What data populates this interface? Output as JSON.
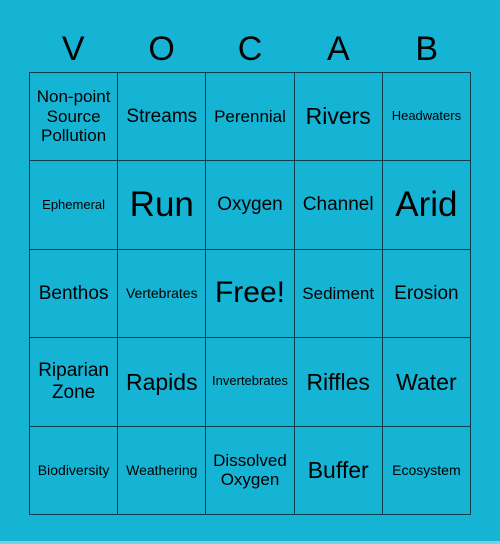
{
  "header": [
    "V",
    "O",
    "C",
    "A",
    "B"
  ],
  "cells": [
    [
      {
        "text": "Non-point Source Pollution",
        "size": "s3"
      },
      {
        "text": "Streams",
        "size": "s4"
      },
      {
        "text": "Perennial",
        "size": "s3"
      },
      {
        "text": "Rivers",
        "size": "s5"
      },
      {
        "text": "Headwaters",
        "size": "s1"
      }
    ],
    [
      {
        "text": "Ephemeral",
        "size": "s1"
      },
      {
        "text": "Run",
        "size": "s7"
      },
      {
        "text": "Oxygen",
        "size": "s4"
      },
      {
        "text": "Channel",
        "size": "s4"
      },
      {
        "text": "Arid",
        "size": "s7"
      }
    ],
    [
      {
        "text": "Benthos",
        "size": "s4"
      },
      {
        "text": "Vertebrates",
        "size": "s2"
      },
      {
        "text": "Free!",
        "size": "s6"
      },
      {
        "text": "Sediment",
        "size": "s3"
      },
      {
        "text": "Erosion",
        "size": "s4"
      }
    ],
    [
      {
        "text": "Riparian Zone",
        "size": "s4"
      },
      {
        "text": "Rapids",
        "size": "s5"
      },
      {
        "text": "Invertebrates",
        "size": "s1"
      },
      {
        "text": "Riffles",
        "size": "s5"
      },
      {
        "text": "Water",
        "size": "s5"
      }
    ],
    [
      {
        "text": "Biodiversity",
        "size": "s2"
      },
      {
        "text": "Weathering",
        "size": "s2"
      },
      {
        "text": "Dissolved Oxygen",
        "size": "s3"
      },
      {
        "text": "Buffer",
        "size": "s5"
      },
      {
        "text": "Ecosystem",
        "size": "s2"
      }
    ]
  ],
  "colors": {
    "background": "#16b4d4",
    "grid_line": "#0c3d4a"
  }
}
